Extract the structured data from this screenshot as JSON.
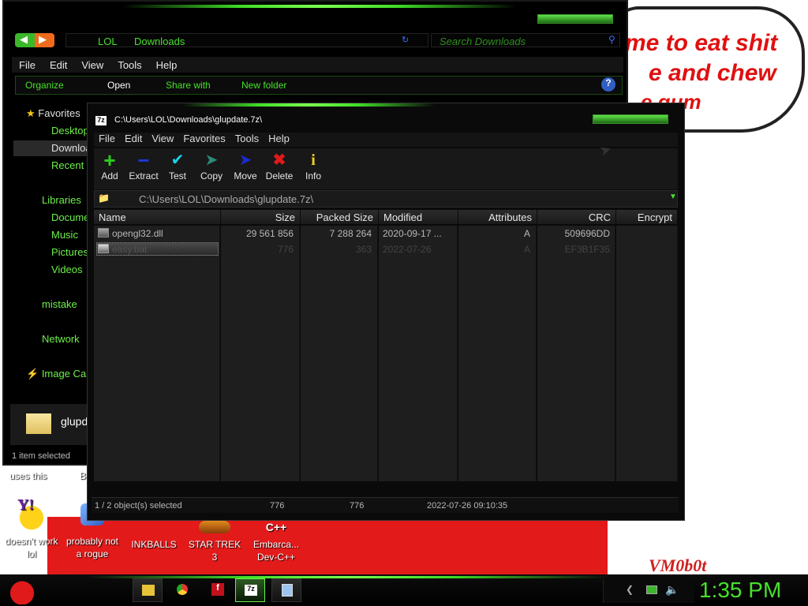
{
  "desktop": {
    "speech_lines": [
      "me to eat shit",
      "e and chew",
      "e gum"
    ],
    "icons": [
      {
        "label_lines": [
          "uses this"
        ],
        "icon": "shortcut-icon"
      },
      {
        "label_lines": [
          "B"
        ],
        "icon": "shortcut-icon"
      },
      {
        "label_lines": [
          "doesn't work",
          "lol"
        ],
        "icon": "yahoo-messenger-icon"
      },
      {
        "label_lines": [
          "probably not",
          "a rogue"
        ],
        "icon": "setup-icon"
      },
      {
        "label_lines": [
          "INKBALLS"
        ],
        "icon": "inkball-icon"
      },
      {
        "label_lines": [
          "STAR TREK",
          "3"
        ],
        "icon": "star-trek-icon"
      },
      {
        "label_lines": [
          "Embarca...",
          "Dev-C++"
        ],
        "icon": "devcpp-icon"
      }
    ],
    "watermark": "VM0b0t"
  },
  "explorer": {
    "breadcrumb": [
      "LOL",
      "Downloads"
    ],
    "search_placeholder": "Search Downloads",
    "menu": [
      "File",
      "Edit",
      "View",
      "Tools",
      "Help"
    ],
    "commands": [
      "Organize",
      "Open",
      "Share with",
      "New folder"
    ],
    "nav": {
      "favorites": "Favorites",
      "desktop": "Desktop",
      "downloads": "Downloads",
      "recent": "Recent",
      "libraries": "Libraries",
      "documents": "Documents",
      "music": "Music",
      "pictures": "Pictures",
      "videos": "Videos",
      "mistake": "mistake",
      "network": "Network",
      "image_ca": "Image Ca"
    },
    "details_name": "glupd",
    "status": "1 item selected"
  },
  "sevenzip": {
    "title": "C:\\Users\\LOL\\Downloads\\glupdate.7z\\",
    "menu": [
      "File",
      "Edit",
      "View",
      "Favorites",
      "Tools",
      "Help"
    ],
    "toolbar": [
      "Add",
      "Extract",
      "Test",
      "Copy",
      "Move",
      "Delete",
      "Info"
    ],
    "path": "C:\\Users\\LOL\\Downloads\\glupdate.7z\\",
    "columns": [
      "Name",
      "Size",
      "Packed Size",
      "Modified",
      "Attributes",
      "CRC",
      "Encrypt"
    ],
    "rows": [
      {
        "name": "opengl32.dll",
        "size": "29 561 856",
        "packed": "7 288 264",
        "modified": "2020-09-17 ...",
        "attr": "A",
        "crc": "509696DD"
      },
      {
        "name": "easy.bat",
        "size": "776",
        "packed": "363",
        "modified": "2022-07-26",
        "attr": "A",
        "crc": "EF3B1F35"
      }
    ],
    "status": {
      "selected": "1 / 2 object(s) selected",
      "size": "776",
      "packed": "776",
      "modified": "2022-07-26 09:10:35"
    }
  },
  "taskbar": {
    "clock": "1:35 PM",
    "accent": "#48e02c"
  }
}
